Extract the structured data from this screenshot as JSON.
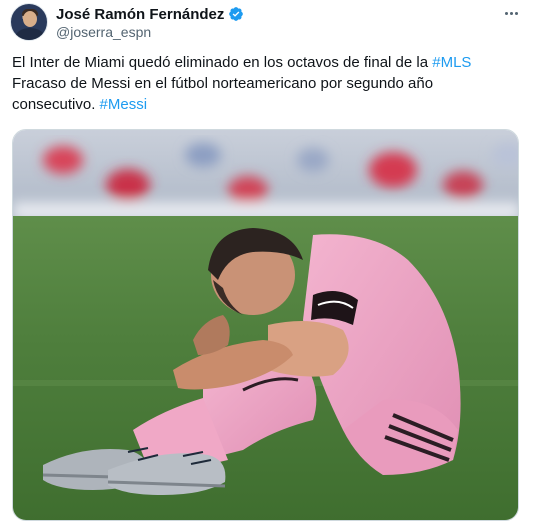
{
  "author": {
    "display_name": "José Ramón Fernández",
    "handle": "@joserra_espn",
    "verified_badge_color": "#1d9bf0"
  },
  "tweet": {
    "line1_text": "El Inter de Miami quedó eliminado en los octavos de final de la ",
    "line1_hashtag": "#MLS",
    "line2_text": "Fracaso de Messi en el fútbol norteamericano por segundo año consecutivo. ",
    "line2_hashtag": "#Messi",
    "hashtag_color": "#1d9bf0"
  },
  "media": {
    "description_icon": "photo-of-dejected-player"
  },
  "icons": {
    "more": "more-options-icon",
    "verified": "verified-badge-icon"
  }
}
